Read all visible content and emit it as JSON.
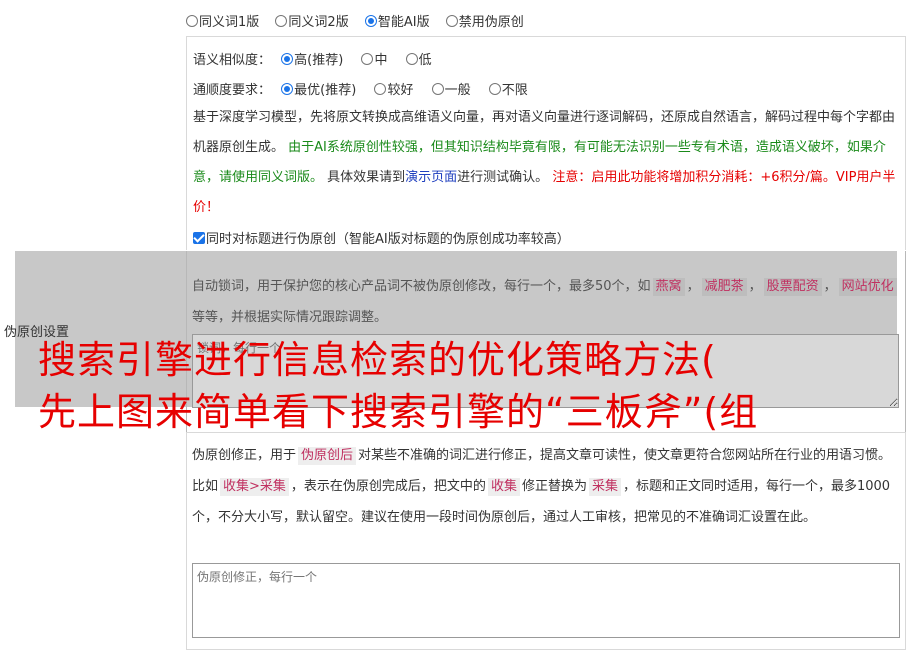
{
  "version": {
    "options": [
      "同义词1版",
      "同义词2版",
      "智能AI版",
      "禁用伪原创"
    ],
    "selected_index": 2
  },
  "similarity": {
    "label": "语义相似度：",
    "options": [
      "高(推荐)",
      "中",
      "低"
    ],
    "selected_index": 0
  },
  "fluency": {
    "label": "通顺度要求：",
    "options": [
      "最优(推荐)",
      "较好",
      "一般",
      "不限"
    ],
    "selected_index": 0
  },
  "description": {
    "part1": "基于深度学习模型，先将原文转换成高维语义向量，再对语义向量进行逐词解码，还原成自然语言，解码过程中每个字都由机器原创生成。 ",
    "green": "由于AI系统原创性较强，但其知识结构毕竟有限，有可能无法识别一些专有术语，造成语义破坏，如果介意，请使用同义词版。",
    "part2": " 具体效果请到",
    "link": "演示页面",
    "part3": "进行测试确认。 ",
    "red": "注意：启用此功能将增加积分消耗：+6积分/篇。VIP用户半价！"
  },
  "title_check": {
    "label": "同时对标题进行伪原创（智能AI版对标题的伪原创成功率较高）",
    "checked": true
  },
  "lock_words": {
    "desc_before": "自动锁词，用于保护您的核心产品词不被伪原创修改，每行一个，最多50个，如",
    "tags": [
      "燕窝",
      "减肥茶",
      "股票配资",
      "网站优化"
    ],
    "sep": "，",
    "desc_after": "等等，并根据实际情况跟踪调整。",
    "placeholder": "锁词，每行一个"
  },
  "side_label": "伪原创设置",
  "overlay": {
    "line1": "搜索引擎进行信息检索的优化策略方法(",
    "line2": "先上图来简单看下搜索引擎的“三板斧”(组"
  },
  "fix_words": {
    "t1": "伪原创修正，用于",
    "tag1": "伪原创后",
    "t2": "对某些不准确的词汇进行修正，提高文章可读性，使文章更符合您网站所在行业的用语习惯。比如",
    "tag2": "收集>采集",
    "t3": "，表示在伪原创完成后，把文中的",
    "tag3": "收集",
    "t4": "修正替换为",
    "tag4": "采集",
    "t5": "，标题和正文同时适用，每行一个，最多1000个，不分大小写，默认留空。建议在使用一段时间伪原创后，通过人工审核，把常见的不准确词汇设置在此。",
    "placeholder": "伪原创修正，每行一个"
  }
}
